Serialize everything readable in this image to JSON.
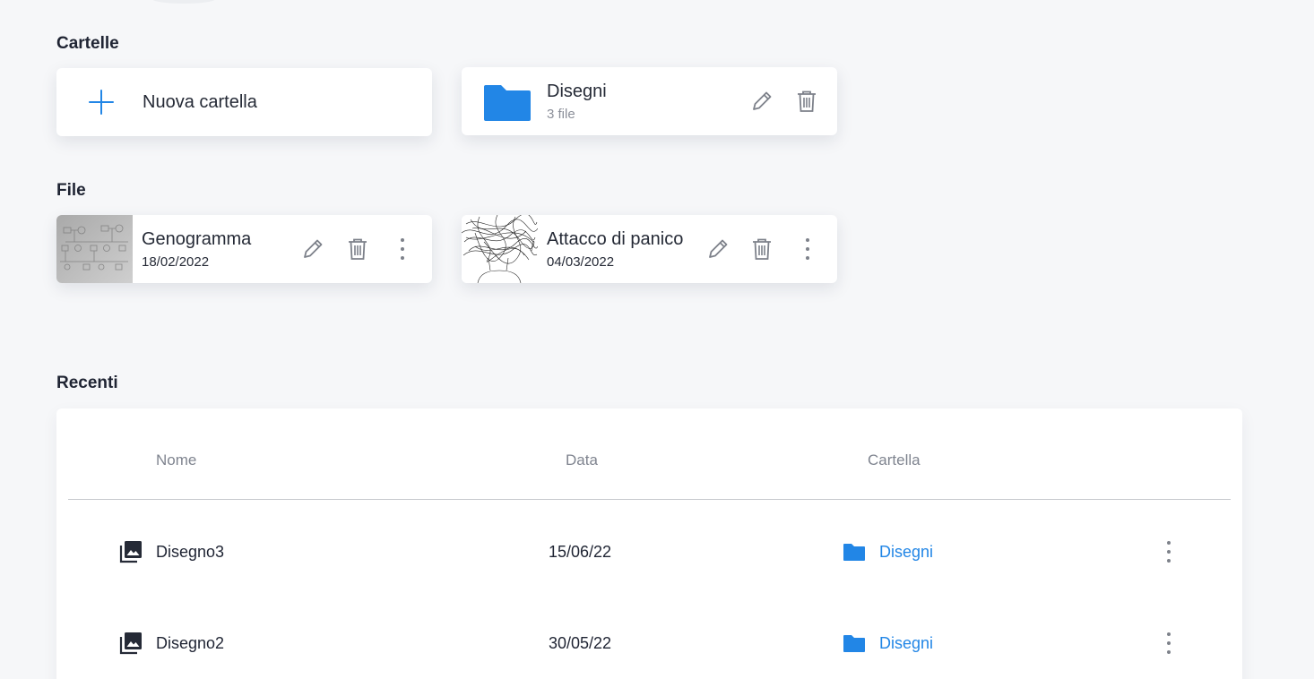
{
  "sections": {
    "folders_title": "Cartelle",
    "files_title": "File",
    "recent_title": "Recenti"
  },
  "new_folder": {
    "label": "Nuova cartella",
    "icon": "plus-icon"
  },
  "folders": [
    {
      "name": "Disegni",
      "count": "3 file",
      "icon": "folder-icon",
      "color": "#2286e6"
    }
  ],
  "files": [
    {
      "name": "Genogramma",
      "date": "18/02/2022",
      "thumbnail": "genogram-sketch"
    },
    {
      "name": "Attacco di panico",
      "date": "04/03/2022",
      "thumbnail": "scribble-drawing"
    }
  ],
  "recent": {
    "columns": {
      "name": "Nome",
      "date": "Data",
      "folder": "Cartella"
    },
    "rows": [
      {
        "name": "Disegno3",
        "date": "15/06/22",
        "folder": "Disegni"
      },
      {
        "name": "Disegno2",
        "date": "30/05/22",
        "folder": "Disegni"
      }
    ]
  },
  "colors": {
    "accent": "#2286e6",
    "background": "#f6f7f9",
    "icon_gray": "#7d818a"
  }
}
